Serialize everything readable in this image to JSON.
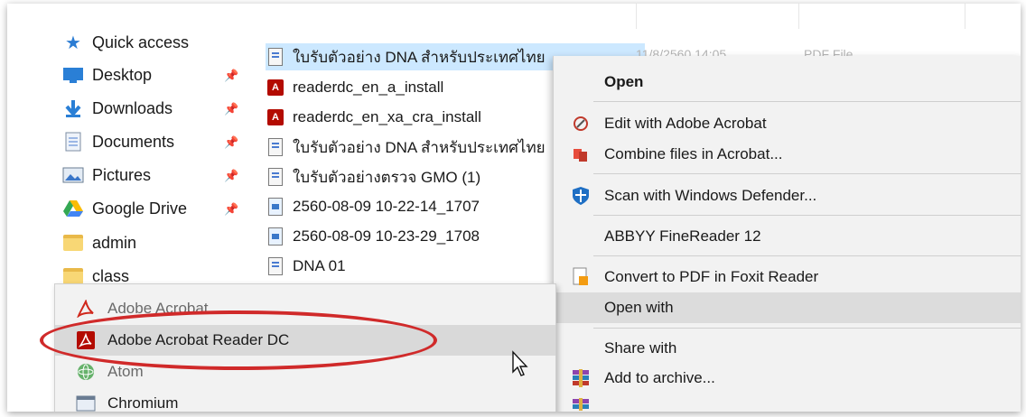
{
  "nav": {
    "items": [
      {
        "label": "Quick access",
        "icon": "star-icon"
      },
      {
        "label": "Desktop",
        "icon": "desktop-icon",
        "pinned": true
      },
      {
        "label": "Downloads",
        "icon": "download-arrow-icon",
        "pinned": true
      },
      {
        "label": "Documents",
        "icon": "documents-icon",
        "pinned": true
      },
      {
        "label": "Pictures",
        "icon": "pictures-icon",
        "pinned": true
      },
      {
        "label": "Google Drive",
        "icon": "google-drive-icon",
        "pinned": true
      },
      {
        "label": "admin",
        "icon": "folder-icon"
      },
      {
        "label": "class",
        "icon": "folder-icon"
      }
    ],
    "pin_glyph": "📌"
  },
  "files": [
    {
      "name": "ใบรับตัวอย่าง DNA สำหรับประเทศไทย",
      "icon": "pdf-file-icon",
      "selected": true
    },
    {
      "name": "readerdc_en_a_install",
      "icon": "acrobat-reader-icon"
    },
    {
      "name": "readerdc_en_xa_cra_install",
      "icon": "acrobat-reader-icon"
    },
    {
      "name": "ใบรับตัวอย่าง DNA สำหรับประเทศไทย",
      "icon": "pdf-file-icon"
    },
    {
      "name": "ใบรับตัวอย่างตรวจ GMO (1)",
      "icon": "pdf-file-icon"
    },
    {
      "name": "2560-08-09 10-22-14_1707",
      "icon": "image-file-icon"
    },
    {
      "name": "2560-08-09 10-23-29_1708",
      "icon": "image-file-icon"
    },
    {
      "name": "DNA 01",
      "icon": "pdf-file-icon"
    }
  ],
  "selected_meta": {
    "date": "11/8/2560 14:05",
    "type": "PDF File"
  },
  "context_menu": {
    "items": [
      {
        "label": "Open",
        "icon": "",
        "bold": true
      },
      {
        "label": "Edit with Adobe Acrobat",
        "icon": "acrobat-edit-icon"
      },
      {
        "label": "Combine files in Acrobat...",
        "icon": "acrobat-combine-icon"
      },
      {
        "label": "Scan with Windows Defender...",
        "icon": "defender-icon"
      },
      {
        "label": "ABBYY FineReader 12",
        "icon": ""
      },
      {
        "label": "Convert to PDF in Foxit Reader",
        "icon": "foxit-icon"
      },
      {
        "label": "Open with",
        "icon": "",
        "hover": true
      },
      {
        "label": "Share with",
        "icon": ""
      },
      {
        "label": "Add to archive...",
        "icon": "winrar-icon"
      }
    ]
  },
  "open_with_menu": {
    "items": [
      {
        "label": "Adobe Acrobat",
        "icon": "adobe-acrobat-icon"
      },
      {
        "label": "Adobe Acrobat Reader DC",
        "icon": "acrobat-reader-icon",
        "hover": true
      },
      {
        "label": "Atom",
        "icon": "atom-icon"
      },
      {
        "label": "Chromium",
        "icon": "chromium-icon"
      }
    ]
  },
  "colors": {
    "selection": "#cce8ff",
    "highlight": "#d02a2a",
    "acrobat_red": "#b30b00"
  }
}
